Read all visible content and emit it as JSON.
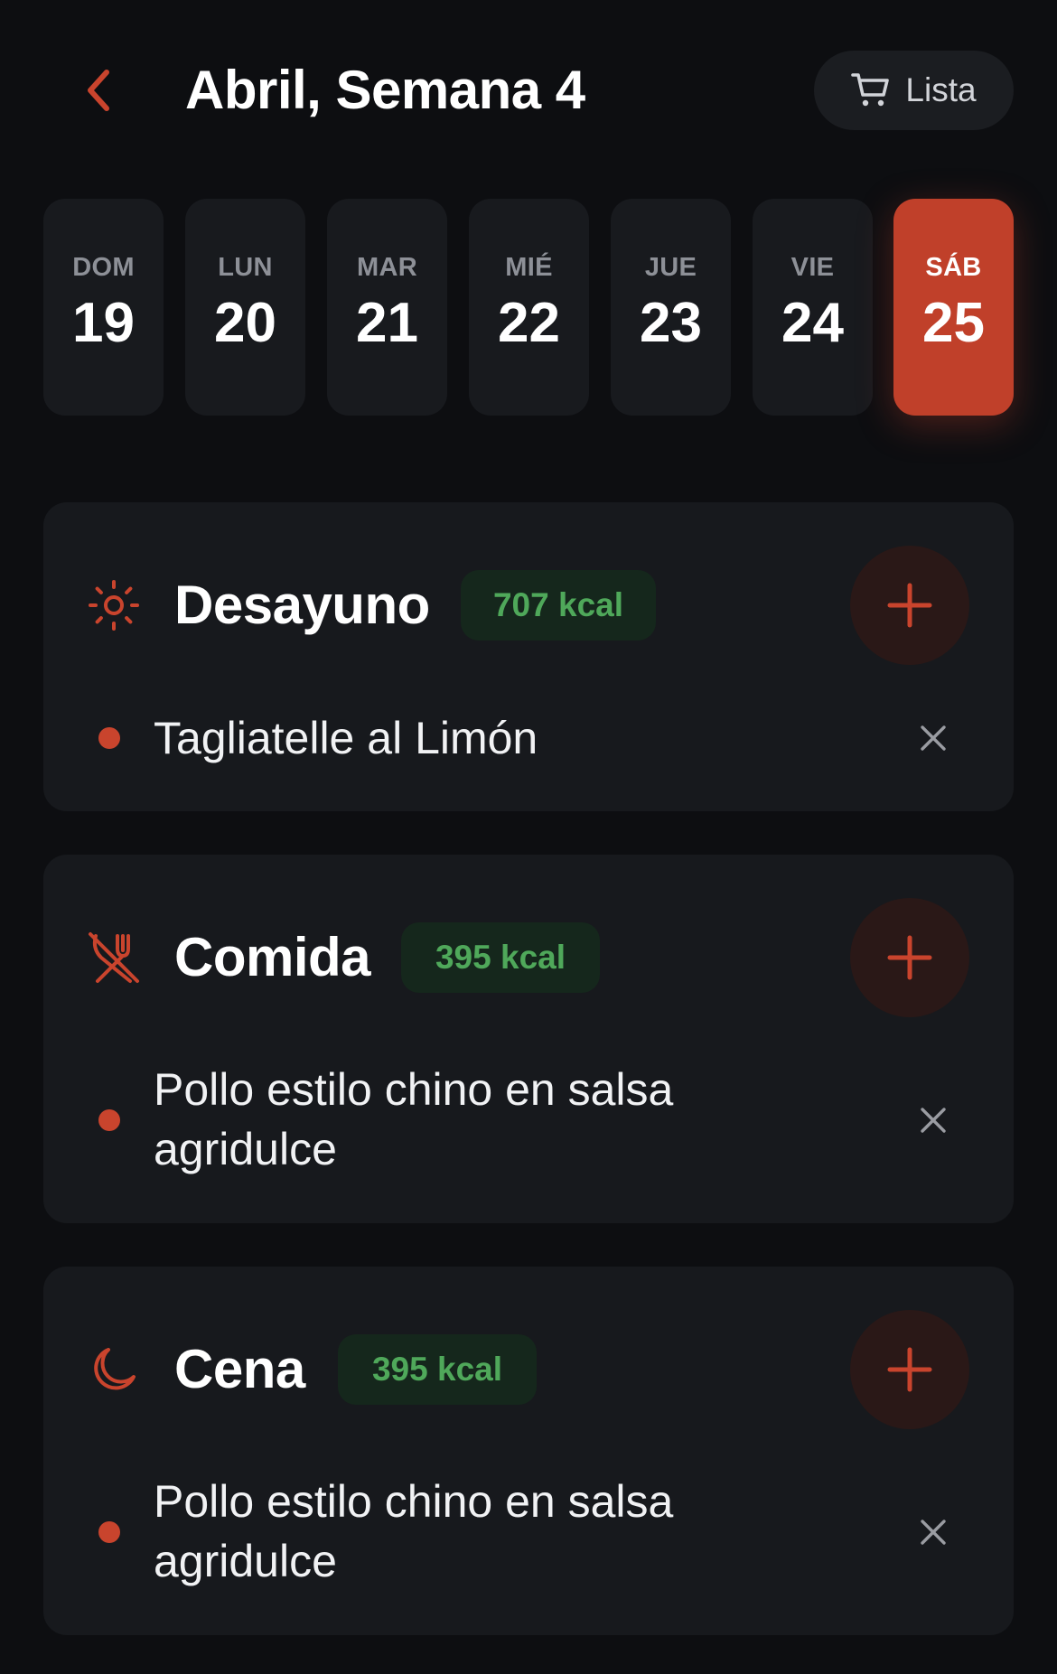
{
  "header": {
    "title": "Abril, Semana 4",
    "list_label": "Lista"
  },
  "days": [
    {
      "name": "DOM",
      "num": "19",
      "active": false
    },
    {
      "name": "LUN",
      "num": "20",
      "active": false
    },
    {
      "name": "MAR",
      "num": "21",
      "active": false
    },
    {
      "name": "MIÉ",
      "num": "22",
      "active": false
    },
    {
      "name": "JUE",
      "num": "23",
      "active": false
    },
    {
      "name": "VIE",
      "num": "24",
      "active": false
    },
    {
      "name": "SÁB",
      "num": "25",
      "active": true
    }
  ],
  "meals": [
    {
      "icon": "sun-icon",
      "title": "Desayuno",
      "kcal": "707 kcal",
      "items": [
        "Tagliatelle al Limón"
      ]
    },
    {
      "icon": "fork-knife-off-icon",
      "title": "Comida",
      "kcal": "395 kcal",
      "items": [
        "Pollo estilo chino en salsa agridulce"
      ]
    },
    {
      "icon": "moon-icon",
      "title": "Cena",
      "kcal": "395 kcal",
      "items": [
        "Pollo estilo chino en salsa agridulce"
      ]
    }
  ],
  "colors": {
    "background": "#0d0e11",
    "card": "#17191d",
    "accent": "#c0402a",
    "kcal_text": "#4fa85a",
    "kcal_bg": "#15271c"
  }
}
